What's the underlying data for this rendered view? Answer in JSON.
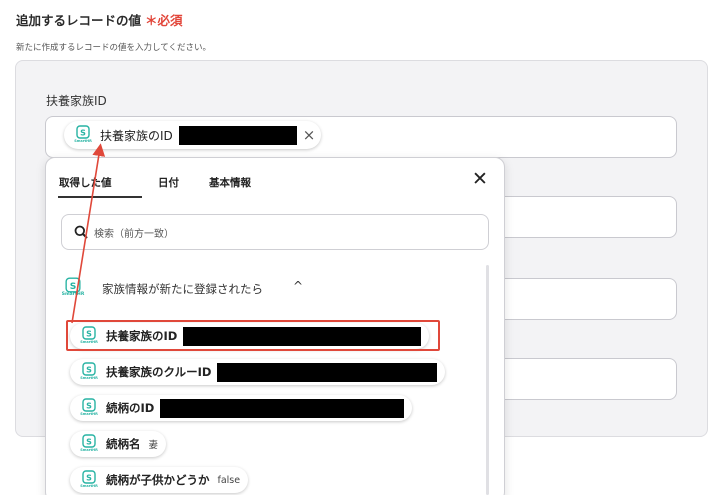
{
  "section": {
    "title": "追加するレコードの値",
    "required_mark": "＊必須",
    "subtitle": "新たに作成するレコードの値を入力してください。"
  },
  "field": {
    "label": "扶養家族ID",
    "selected_chip_label": "扶養家族のID",
    "chip_remove": "×"
  },
  "dropdown": {
    "tabs": [
      {
        "label": "取得した値",
        "active": true
      },
      {
        "label": "日付",
        "active": false
      },
      {
        "label": "基本情報",
        "active": false
      }
    ],
    "close": "✕",
    "search_placeholder": "検索（前方一致）",
    "group": {
      "title": "家族情報が新たに登録されたら",
      "chevron": "^",
      "icon_text": "SmartHR"
    },
    "items": [
      {
        "label": "扶養家族のID",
        "value": ""
      },
      {
        "label": "扶養家族のクルーID",
        "value": ""
      },
      {
        "label": "続柄のID",
        "value": ""
      },
      {
        "label": "続柄名",
        "value": "妻"
      },
      {
        "label": "続柄が子供かどうか",
        "value": "false"
      }
    ]
  },
  "colors": {
    "accent_red": "#e0483a",
    "smarthr_teal": "#27b3a3"
  },
  "icons": {
    "service": "smarthr-icon",
    "search": "search-icon",
    "close": "close-icon"
  }
}
